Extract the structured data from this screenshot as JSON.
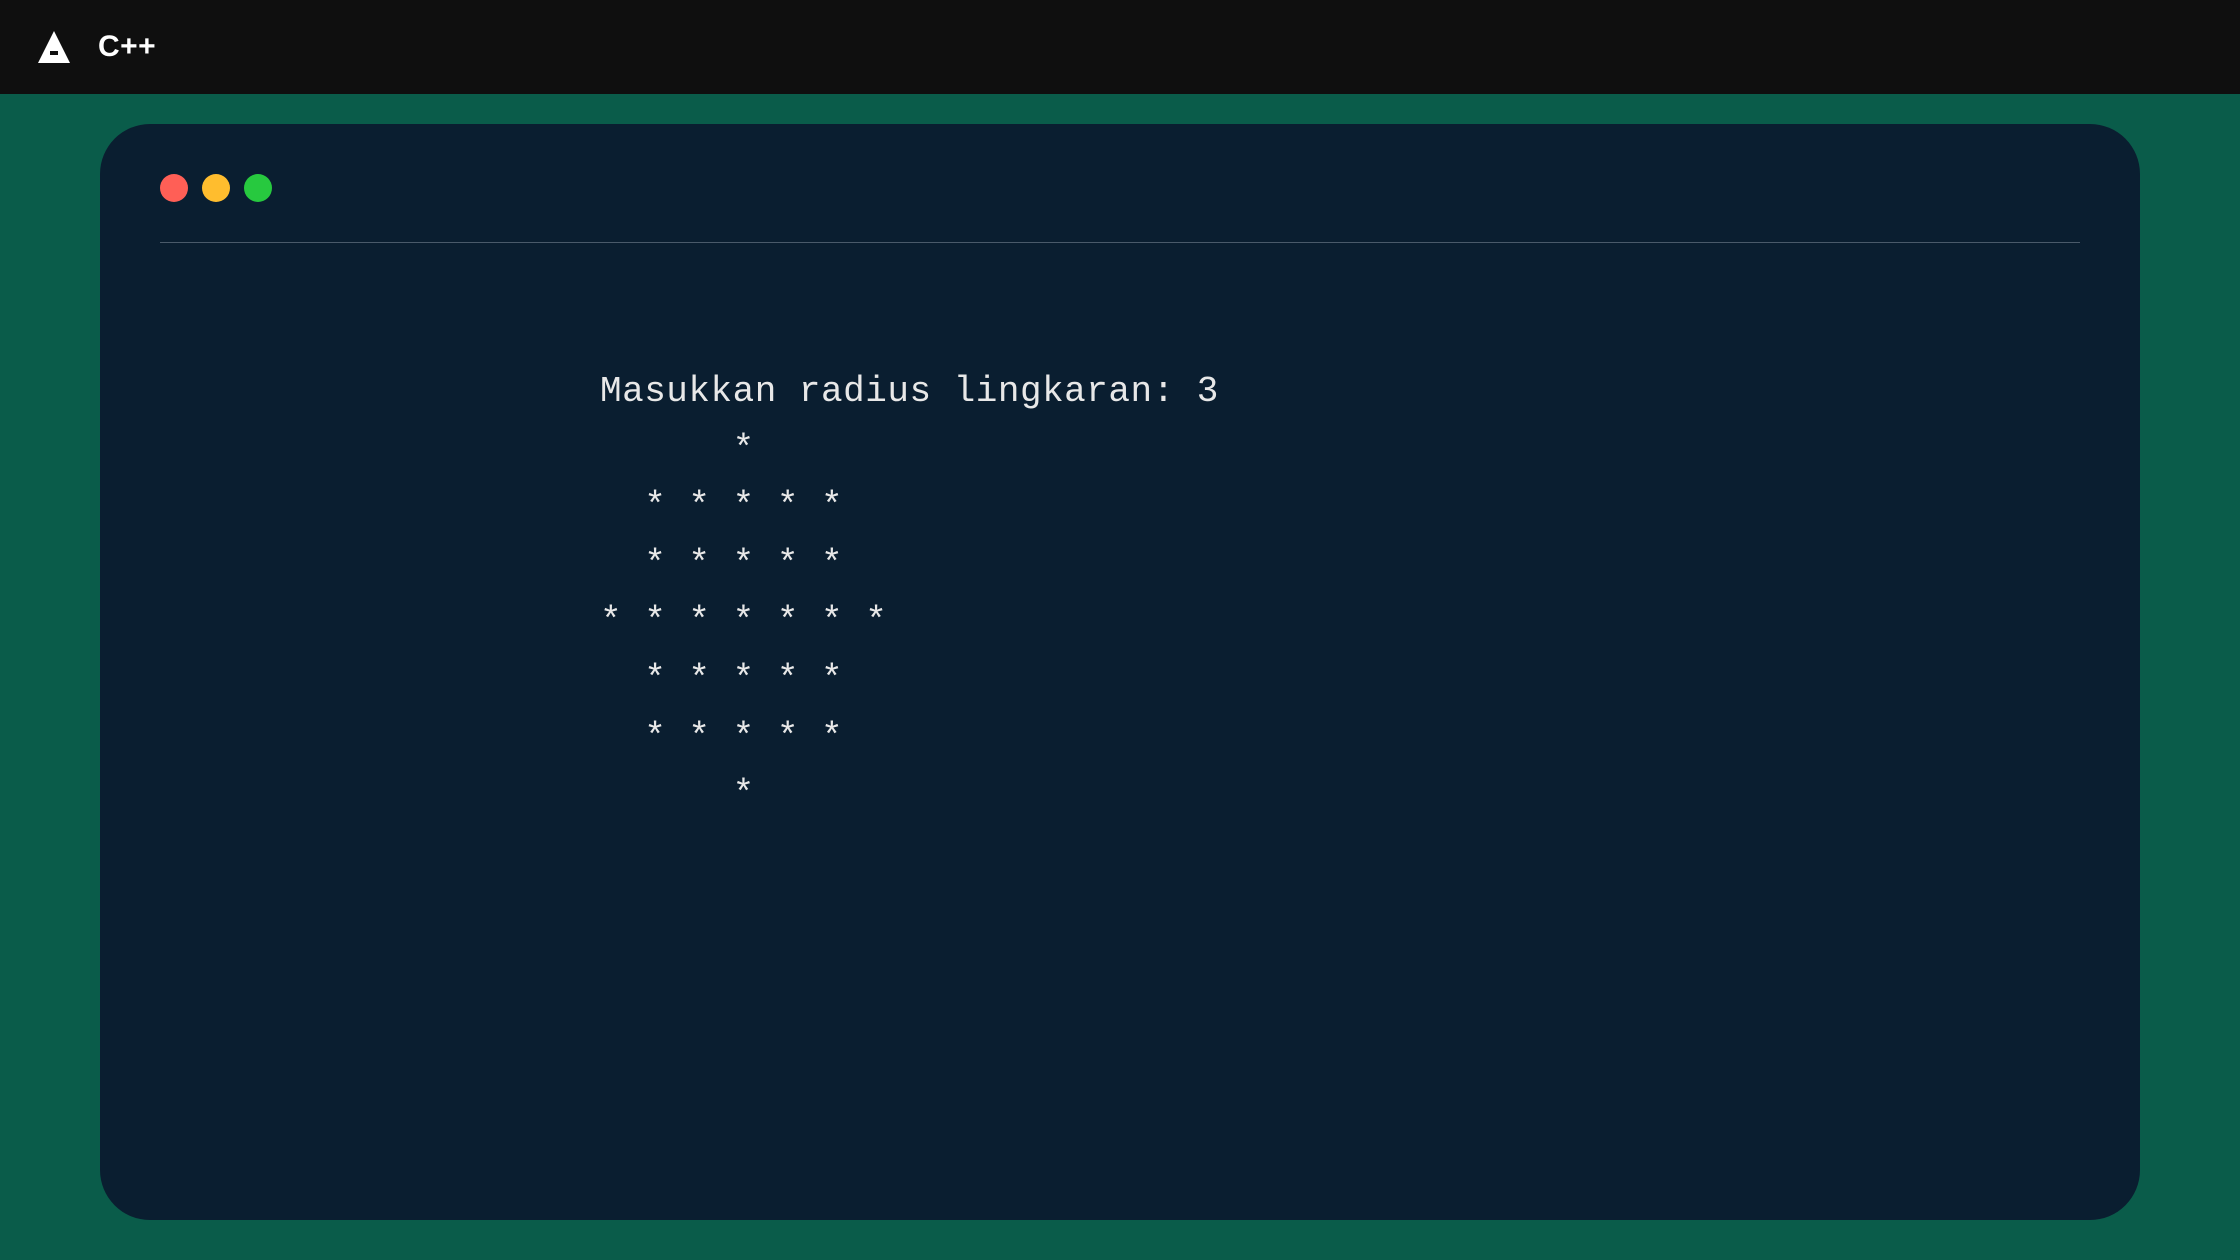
{
  "header": {
    "language_label": "C++"
  },
  "terminal": {
    "output": "Masukkan radius lingkaran: 3\n      *\n  * * * * *\n  * * * * *\n* * * * * * *\n  * * * * *\n  * * * * *\n      *"
  },
  "window_controls": {
    "red": "#ff5f56",
    "yellow": "#ffbd2e",
    "green": "#27c93f"
  }
}
